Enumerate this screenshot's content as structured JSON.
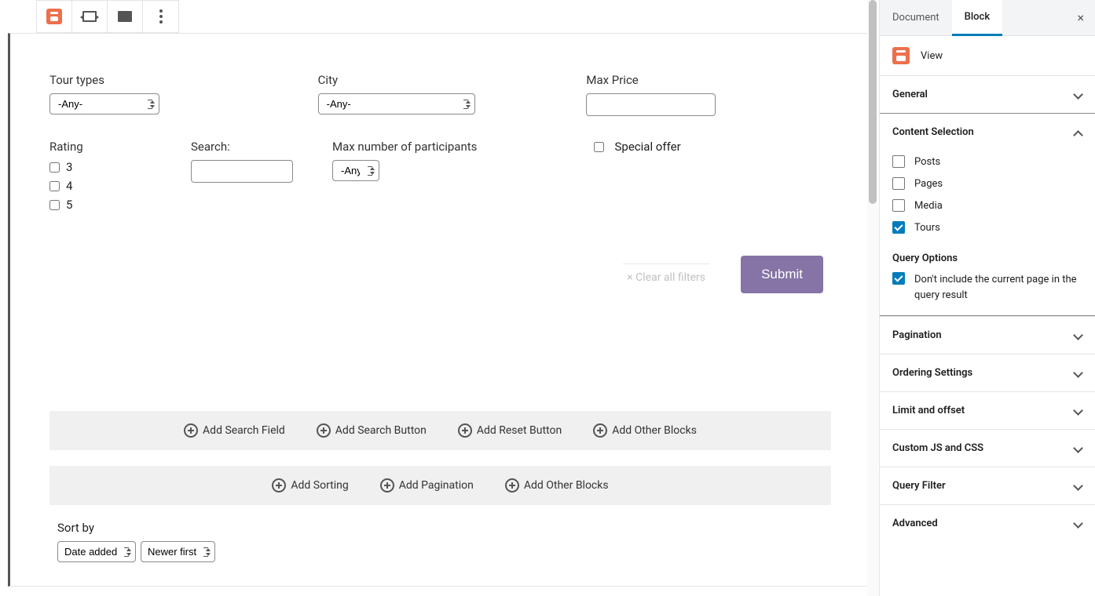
{
  "sidebar": {
    "tabs": {
      "document": "Document",
      "block": "Block"
    },
    "blockInfo": {
      "name": "View"
    },
    "panels": {
      "general": "General",
      "contentSelection": "Content Selection",
      "pagination": "Pagination",
      "ordering": "Ordering Settings",
      "limit": "Limit and offset",
      "customJsCss": "Custom JS and CSS",
      "queryFilter": "Query Filter",
      "advanced": "Advanced"
    },
    "contentTypes": {
      "posts": "Posts",
      "pages": "Pages",
      "media": "Media",
      "tours": "Tours"
    },
    "queryOptions": {
      "title": "Query Options",
      "excludeCurrent": "Don't include the current page in the query result"
    }
  },
  "form": {
    "tourTypes": {
      "label": "Tour types",
      "value": "-Any-"
    },
    "city": {
      "label": "City",
      "value": "-Any-"
    },
    "maxPrice": {
      "label": "Max Price",
      "value": ""
    },
    "rating": {
      "label": "Rating",
      "options": [
        "3",
        "4",
        "5"
      ]
    },
    "search": {
      "label": "Search:",
      "value": ""
    },
    "maxParticipants": {
      "label": "Max number of participants",
      "value": "-Any-"
    },
    "specialOffer": {
      "label": "Special offer"
    },
    "clearFilters": "× Clear all filters",
    "submit": "Submit"
  },
  "addButtons": {
    "row1": [
      "Add Search Field",
      "Add Search Button",
      "Add Reset Button",
      "Add Other Blocks"
    ],
    "row2": [
      "Add Sorting",
      "Add Pagination",
      "Add Other Blocks"
    ]
  },
  "sort": {
    "label": "Sort by",
    "field": "Date added",
    "order": "Newer first"
  }
}
